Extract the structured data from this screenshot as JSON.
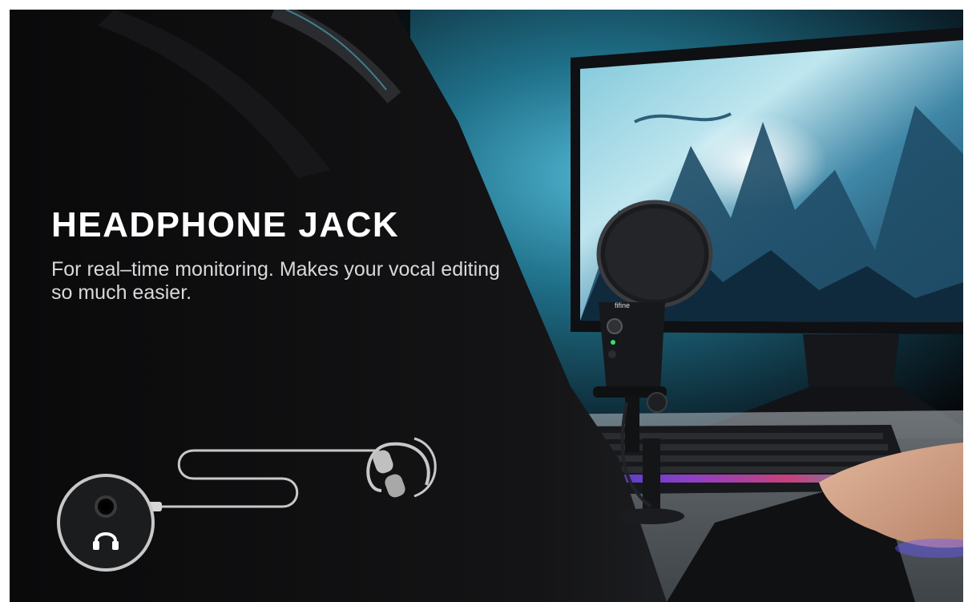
{
  "banner": {
    "title": "HEADPHONE JACK",
    "subtitle": "For real–time monitoring. Makes your vocal editing so much easier."
  },
  "microphone": {
    "brand_mark": "fifine"
  },
  "icons": {
    "jack": "headphone-jack-icon",
    "headphones": "headphones-icon",
    "cable": "audio-cable-icon"
  },
  "colors": {
    "background_dark": "#0b0c0e",
    "text_primary": "#ffffff",
    "text_secondary": "#d9d9d9",
    "illustration_stroke": "#c8c8c8",
    "screen_teal": "#5ab7d3"
  }
}
